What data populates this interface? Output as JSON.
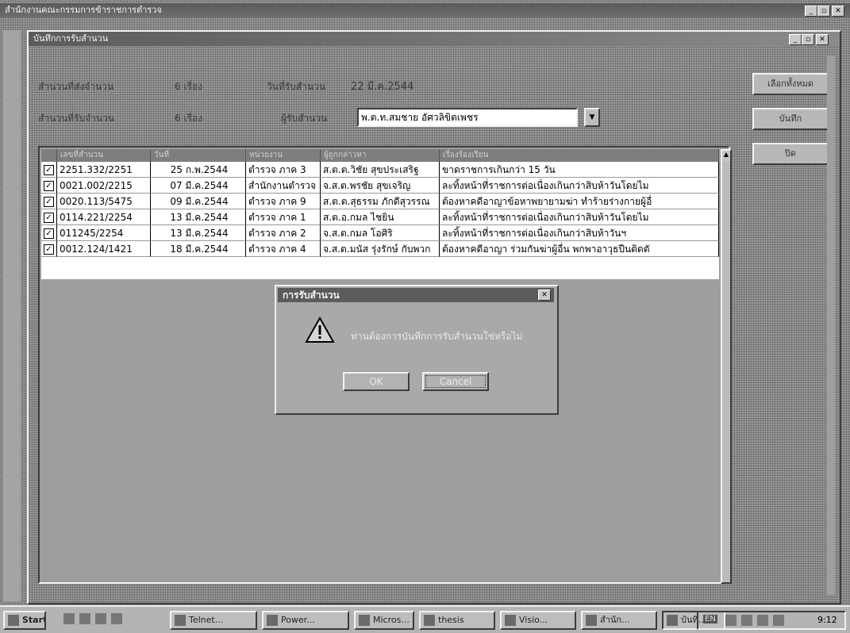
{
  "app": {
    "title": "สำนักงานคณะกรรมการข้าราชการตำรวจ",
    "buttons": [
      "_",
      "▫",
      "✕"
    ]
  },
  "document_window": {
    "title": "บันทึกการรับสำนวน",
    "buttons": [
      "_",
      "▫",
      "✕"
    ]
  },
  "form": {
    "total_label": "สำนวนที่ส่งจำนวน",
    "total_value": "6 เรื่อง",
    "received_label": "สำนวนที่รับจำนวน",
    "received_value": "6 เรื่อง",
    "date_label": "วันที่รับสำนวน",
    "date_value": "22 มี.ค.2544",
    "receiver_label": "ผู้รับสำนวน",
    "receiver_value": "พ.ต.ท.สมชาย อัศวลิขิตเพชร"
  },
  "side_buttons": {
    "select_all": "เลือกทั้งหมด",
    "save": "บันทึก",
    "close": "ปิด"
  },
  "grid": {
    "headers": [
      "เลขที่สำนวน",
      "วันที่",
      "หน่วยงาน",
      "ผู้ถูกกล่าวหา",
      "เรื่องร้องเรียน"
    ],
    "rows": [
      {
        "checked": true,
        "no": "2251.332/2251",
        "date": "25 ก.พ.2544",
        "unit": "ตำรวจ ภาค 3",
        "accused": "ส.ต.ต.วิชัย สุขประเสริฐ",
        "subject": "ขาดราชการเกินกว่า 15 วัน"
      },
      {
        "checked": true,
        "no": "0021.002/2215",
        "date": "07 มี.ค.2544",
        "unit": "สำนักงานตำรวจ",
        "accused": "จ.ส.ต.พรชัย สุขเจริญ",
        "subject": "ละทิ้งหน้าที่ราชการต่อเนื่องเกินกว่าสิบห้าวันโดยไม"
      },
      {
        "checked": true,
        "no": "0020.113/5475",
        "date": "09 มี.ค.2544",
        "unit": "ตำรวจ ภาค 9",
        "accused": "ส.ต.ต.สุธรรม ภักดีสุวรรณ",
        "subject": "ต้องหาคดีอาญาข้อหาพยายามฆ่า ทำร้ายร่างกายผู้อื่"
      },
      {
        "checked": true,
        "no": "0114.221/2254",
        "date": "13 มี.ค.2544",
        "unit": "ตำรวจ ภาค 1",
        "accused": "ส.ต.อ.กมล ไชยิน",
        "subject": "ละทิ้งหน้าที่ราชการต่อเนื่องเกินกว่าสิบห้าวันโดยไม"
      },
      {
        "checked": true,
        "no": "011245/2254",
        "date": "13 มี.ค.2544",
        "unit": "ตำรวจ ภาค 2",
        "accused": "จ.ส.ต.กมล โอศิริ",
        "subject": "ละทิ้งหน้าที่ราชการต่อเนื่องเกินกว่าสิบห้าวันฯ"
      },
      {
        "checked": true,
        "no": "0012.124/1421",
        "date": "18 มี.ค.2544",
        "unit": "ตำรวจ ภาค 4",
        "accused": "จ.ส.ต.มนัส รุ่งรักษ์ กับพวก",
        "subject": "ต้องหาคดีอาญา ร่วมกันฆ่าผู้อื่น พกพาอาวุธปืนติดตั"
      }
    ]
  },
  "dialog": {
    "title": "การรับสำนวน",
    "message": "ท่านต้องการบันทึกการรับสำนวนใช่หรือไม่",
    "ok_label": "OK",
    "cancel_label": "Cancel",
    "close_glyph": "✕",
    "icon": "warning-icon"
  },
  "taskbar": {
    "start_label": "Start",
    "tasks": [
      "Telnet...",
      "Power...",
      "Micros...",
      "thesis",
      "Visio...",
      "สำนัก...",
      "บันทึ..."
    ],
    "clock": "9:12",
    "tray_label": "EN"
  }
}
